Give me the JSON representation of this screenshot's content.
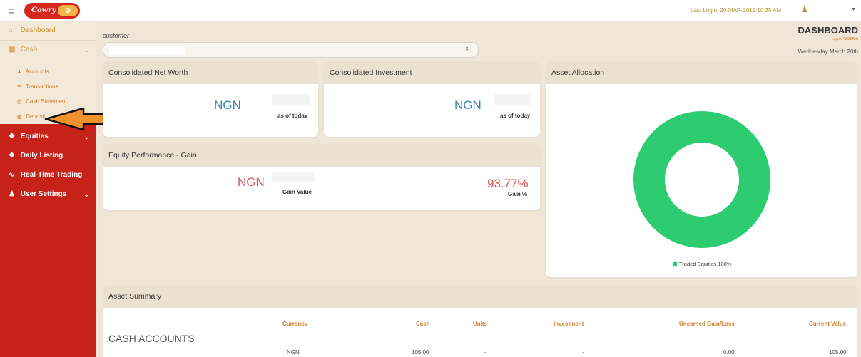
{
  "header": {
    "logo_text": "Cowry",
    "last_login": "Last Login: 20-MAR-2019 10:35 AM"
  },
  "sidebar": {
    "items": [
      {
        "label": "Dashboard",
        "icon": "home-icon"
      },
      {
        "label": "Cash",
        "icon": "money-icon"
      },
      {
        "label": "Equities",
        "icon": "cubes-icon"
      },
      {
        "label": "Daily Listing",
        "icon": "cube-icon"
      },
      {
        "label": "Real-Time Trading",
        "icon": "chart-icon"
      },
      {
        "label": "User Settings",
        "icon": "user-icon"
      }
    ],
    "cash_subitems": [
      {
        "label": "Accounts",
        "icon": "user-icon"
      },
      {
        "label": "Transactions",
        "icon": "list-icon"
      },
      {
        "label": "Cash Statement",
        "icon": "print-icon"
      },
      {
        "label": "Deposit",
        "icon": "money-icon"
      }
    ]
  },
  "page": {
    "customer_label": "customer",
    "title": "DASHBOARD",
    "subtitle": "Lagos, NIGERIA",
    "date": "Wednesday March 20th"
  },
  "cards": {
    "net_worth": {
      "title": "Consolidated Net Worth",
      "currency": "NGN",
      "label": "as of today"
    },
    "investment": {
      "title": "Consolidated Investment",
      "currency": "NGN",
      "label": "as of today"
    },
    "allocation": {
      "title": "Asset Allocation",
      "legend": "Traded Equities 100%",
      "color": "#2ecc71"
    },
    "equity_perf": {
      "title": "Equity Performance - Gain",
      "currency": "NGN",
      "gain_value_label": "Gain Value",
      "gain_pct": "93.77%",
      "gain_pct_label": "Gain %"
    }
  },
  "asset_summary": {
    "title": "Asset Summary",
    "headers": [
      "Currency",
      "Cash",
      "Units",
      "Investment",
      "Unearned Gain/Loss",
      "Current Value"
    ],
    "section": "CASH ACCOUNTS",
    "row": [
      "NGN",
      "105.00",
      "-",
      "-",
      "0.00",
      "105.00"
    ]
  },
  "colors": {
    "accent_red": "#c62219",
    "accent_orange": "#d0812f",
    "value_blue": "#3a7fb5",
    "value_red": "#d9534f"
  }
}
